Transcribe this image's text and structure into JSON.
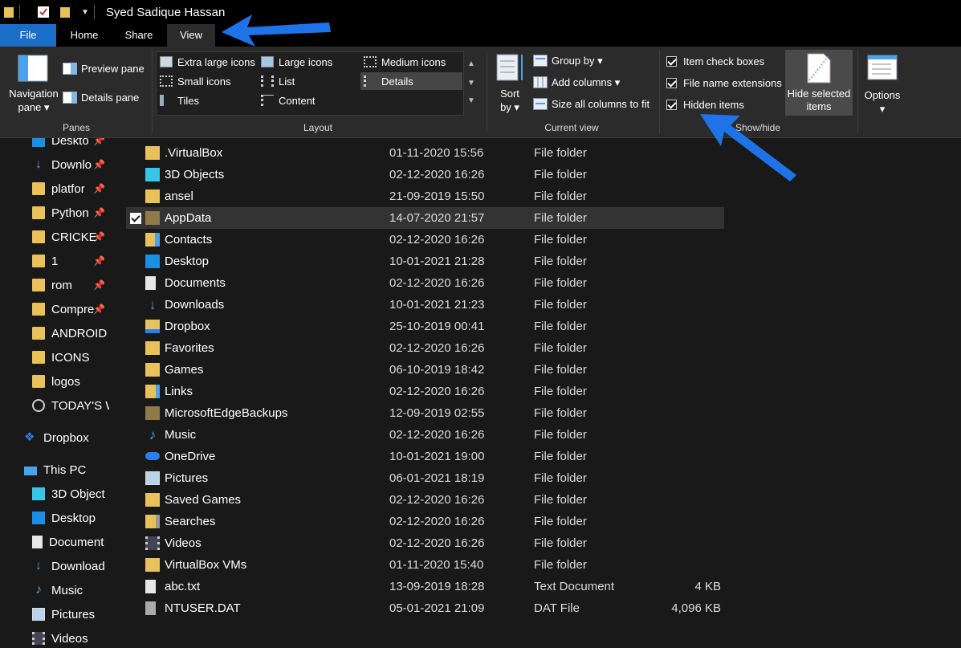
{
  "window": {
    "title": "Syed Sadique Hassan"
  },
  "tabs": [
    "File",
    "Home",
    "Share",
    "View"
  ],
  "ribbon": {
    "panes": {
      "navigation_pane": "Navigation pane ▾",
      "preview_pane": "Preview pane",
      "details_pane": "Details pane",
      "group_label": "Panes"
    },
    "layout": {
      "items": [
        "Extra large icons",
        "Large icons",
        "Medium icons",
        "Small icons",
        "List",
        "Details",
        "Tiles",
        "Content"
      ],
      "selected": "Details",
      "group_label": "Layout"
    },
    "current_view": {
      "sort_by": "Sort by ▾",
      "group_by": "Group by ▾",
      "add_columns": "Add columns ▾",
      "size_all_columns": "Size all columns to fit",
      "group_label": "Current view"
    },
    "show_hide": {
      "item_check_boxes": "Item check boxes",
      "file_name_extensions": "File name extensions",
      "hidden_items": "Hidden items",
      "checked": [
        true,
        true,
        true
      ],
      "hide_selected_items": "Hide selected items",
      "group_label": "Show/hide"
    },
    "options": "Options ▾"
  },
  "nav": {
    "quick_access": [
      "Deskto",
      "Downlo",
      "platfor",
      "Python",
      "CRICKE",
      "1",
      "rom",
      "Compre",
      "ANDROID",
      "ICONS",
      "logos",
      "TODAY'S W"
    ],
    "pinned": [
      true,
      true,
      true,
      true,
      true,
      true,
      true,
      true,
      false,
      false,
      false,
      false
    ],
    "dropbox": "Dropbox",
    "this_pc": "This PC",
    "this_pc_items": [
      "3D Object",
      "Desktop",
      "Document",
      "Download",
      "Music",
      "Pictures",
      "Videos"
    ]
  },
  "files": [
    {
      "name": ".VirtualBox",
      "date": "01-11-2020 15:56",
      "type": "File folder",
      "size": "",
      "icon": "folder-icon"
    },
    {
      "name": "3D Objects",
      "date": "02-12-2020 16:26",
      "type": "File folder",
      "size": "",
      "icon": "3d-objects-icon"
    },
    {
      "name": "ansel",
      "date": "21-09-2019 15:50",
      "type": "File folder",
      "size": "",
      "icon": "folder-icon"
    },
    {
      "name": "AppData",
      "date": "14-07-2020 21:57",
      "type": "File folder",
      "size": "",
      "icon": "hidden-folder-icon"
    },
    {
      "name": "Contacts",
      "date": "02-12-2020 16:26",
      "type": "File folder",
      "size": "",
      "icon": "contacts-icon"
    },
    {
      "name": "Desktop",
      "date": "10-01-2021 21:28",
      "type": "File folder",
      "size": "",
      "icon": "desktop-icon"
    },
    {
      "name": "Documents",
      "date": "02-12-2020 16:26",
      "type": "File folder",
      "size": "",
      "icon": "documents-icon"
    },
    {
      "name": "Downloads",
      "date": "10-01-2021 21:23",
      "type": "File folder",
      "size": "",
      "icon": "downloads-icon"
    },
    {
      "name": "Dropbox",
      "date": "25-10-2019 00:41",
      "type": "File folder",
      "size": "",
      "icon": "dropbox-icon"
    },
    {
      "name": "Favorites",
      "date": "02-12-2020 16:26",
      "type": "File folder",
      "size": "",
      "icon": "favorites-icon"
    },
    {
      "name": "Games",
      "date": "06-10-2019 18:42",
      "type": "File folder",
      "size": "",
      "icon": "folder-icon"
    },
    {
      "name": "Links",
      "date": "02-12-2020 16:26",
      "type": "File folder",
      "size": "",
      "icon": "links-icon"
    },
    {
      "name": "MicrosoftEdgeBackups",
      "date": "12-09-2019 02:55",
      "type": "File folder",
      "size": "",
      "icon": "hidden-folder-icon"
    },
    {
      "name": "Music",
      "date": "02-12-2020 16:26",
      "type": "File folder",
      "size": "",
      "icon": "music-icon"
    },
    {
      "name": "OneDrive",
      "date": "10-01-2021 19:00",
      "type": "File folder",
      "size": "",
      "icon": "onedrive-icon"
    },
    {
      "name": "Pictures",
      "date": "06-01-2021 18:19",
      "type": "File folder",
      "size": "",
      "icon": "pictures-icon"
    },
    {
      "name": "Saved Games",
      "date": "02-12-2020 16:26",
      "type": "File folder",
      "size": "",
      "icon": "saved-games-icon"
    },
    {
      "name": "Searches",
      "date": "02-12-2020 16:26",
      "type": "File folder",
      "size": "",
      "icon": "searches-icon"
    },
    {
      "name": "Videos",
      "date": "02-12-2020 16:26",
      "type": "File folder",
      "size": "",
      "icon": "videos-icon"
    },
    {
      "name": "VirtualBox VMs",
      "date": "01-11-2020 15:40",
      "type": "File folder",
      "size": "",
      "icon": "folder-icon"
    },
    {
      "name": "abc.txt",
      "date": "13-09-2019 18:28",
      "type": "Text Document",
      "size": "4 KB",
      "icon": "text-file-icon"
    },
    {
      "name": "NTUSER.DAT",
      "date": "05-01-2021 21:09",
      "type": "DAT File",
      "size": "4,096 KB",
      "icon": "dat-file-icon"
    }
  ],
  "selected_file": "AppData",
  "colors": {
    "accent": "#1a6ec7",
    "annotation_arrow": "#1e73e8",
    "folder": "#e8c15a",
    "background": "#191919"
  }
}
